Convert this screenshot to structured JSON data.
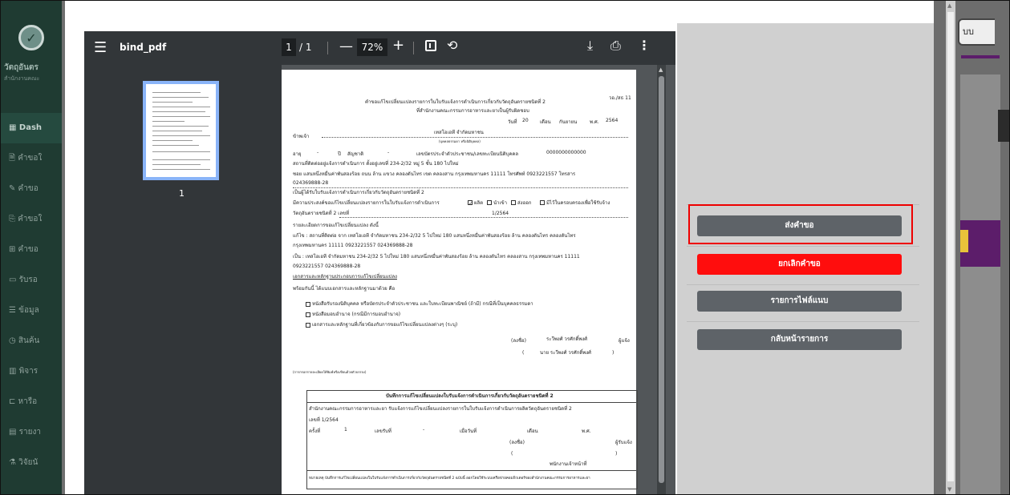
{
  "sidebar": {
    "brand": "วัตถุอันตร",
    "brand_sub": "สำนักงานคณะ",
    "items": [
      {
        "label": "▦ Dash",
        "active": true
      },
      {
        "label": "🗎 คำขอใ"
      },
      {
        "label": "✎ คำขอ"
      },
      {
        "label": "⎘ คำขอใ"
      },
      {
        "label": "⊞ คำขอ"
      },
      {
        "label": "▭ รับรอ"
      },
      {
        "label": "☰ ข้อมูล"
      },
      {
        "label": "◷ สินค้น"
      },
      {
        "label": "▥ พิจาร"
      },
      {
        "label": "⊏ หารือ"
      },
      {
        "label": "▤ รายงา"
      },
      {
        "label": "⚗ วิจัยนั"
      }
    ]
  },
  "background": {
    "top_button_label": "บบ"
  },
  "pdf": {
    "title": "bind_pdf",
    "current_page": "1",
    "total_pages": "/ 1",
    "zoom": "72%",
    "thumb_page_label": "1",
    "icons": {
      "menu": "menu-icon",
      "fit": "fit-page-icon",
      "rotate": "rotate-icon",
      "download": "download-icon",
      "print": "print-icon",
      "more": "more-vertical-icon"
    }
  },
  "document": {
    "form_code": "วอ./สธ 11",
    "title_1": "คำขอแก้ไขเปลี่ยนแปลงรายการในใบรับแจ้งการดำเนินการเกี่ยวกับวัตถุอันตรายชนิดที่ 2",
    "title_2": "ที่สำนักงานคณะกรรมการอาหารและยาเป็นผู้รับผิดชอบ",
    "date_day_label": "วันที่",
    "date_day": "20",
    "date_month_label": "เดือน",
    "date_month": "กันยายน",
    "date_year_label": "พ.ศ.",
    "date_year": "2564",
    "applicant_label": "ข้าพเจ้า",
    "applicant": "เทสโอเอที จำกัดมหาชน",
    "applicant_hint": "(บุคคลธรรมดา หรือนิติบุคคล)",
    "age_label": "อายุ",
    "age": "-",
    "year_label": "ปี",
    "nationality_label": "สัญชาติ",
    "nationality": "-",
    "id_label": "เลขบัตรประจำตัวประชาชน/เลขทะเบียนนิติบุคคล",
    "id_value": "0000000000000",
    "address_line_1": "สถานที่ติดต่ออยู่แจ้งการดำเนินการ ตั้งอยู่เลขที่ 234-2/32 หมู่ 5 ชั้น 180 ไปใหม่",
    "address_line_2": "ซอย แสนหนึ่งหมื่นค่าพันสองร้อย ถนน ล้าน แขวง คลองตันไทร เขต คลองสาน กรุงเทพมหานคร 11111 โทรศัพท์ 0923221557 โทรสาร",
    "address_line_3": "024369888-28",
    "holder_line": "เป็นผู้ได้รับใบรับแจ้งการดำเนินการเกี่ยวกับวัตถุอันตรายชนิดที่ 2",
    "purpose_line": "มีความประสงค์ขอแก้ไขเปลี่ยนแปลงรายการในใบรับแจ้งการดำเนินการ",
    "opt_produce": "ผลิต",
    "opt_import": "นำเข้า",
    "opt_export": "ส่งออก",
    "opt_possess": "มีไว้ในครอบครองเพื่อใช้รับจ้าง",
    "type_line": "วัตถุอันตรายชนิดที่ 2 เลขที่",
    "type_no": "1/2564",
    "details_label": "รายละเอียดการขอแก้ไขเปลี่ยนแปลง ดังนี้",
    "edit_line_1": "แก้ไข : สถานที่ติดต่อ จาก เทสโอเอที จำกัดมหาชน 234-2/32 5 ไปใหม่ 180 แสนหนึ่งหมื่นค่าพันสองร้อย ล้าน คลองตันไทร คลองตันไทร",
    "edit_line_2": "กรุงเทพมหานคร 11111 0923221557 024369888-28",
    "edit_line_3": "เป็น : เทสโอเอที จำกัดมหาชน 234-2/32 5 ไปใหม่ 180 แสนหนึ่งหมื่นค่าพันสองร้อย ล้าน คลองตันไทร คลองสาน กรุงเทพมหานคร 11111",
    "edit_line_4": "0923221557 024369888-28",
    "evidence_label": "เอกสารและหลักฐานประกอบการแก้ไขเปลี่ยนแปลง",
    "attached_label": "พร้อมกันนี้ ได้แนบเอกสารและหลักฐานมาด้วย คือ",
    "doc_1": "หนังสือรับรองนิติบุคคล หรือบัตรประจำตัวประชาชน และใบทะเบียนพาณิชย์ (ถ้ามี) กรณีที่เป็นบุคคลธรรมดา",
    "doc_2": "หนังสือมอบอำนาจ (กรณีมีการมอบอำนาจ)",
    "doc_3": "เอกสารและหลักฐานที่เกี่ยวข้องกับการขอแก้ไขเปลี่ยนแปลงต่างๆ  (ระบุ)",
    "sign_label": "(ลงชื่อ)",
    "sign_name": "ระวีพงศ์ วรศักดิ์พงศ์",
    "sign_role": "ผู้แจ้ง",
    "sign_name_paren": "นาย ระวีพงศ์ วรศักดิ์พงศ์",
    "note_small": "(การกรอกรายละเอียดให้พิมพ์หรือเขียนด้วยตัวบรรจง)",
    "record_title": "บันทึกการแก้ไขเปลี่ยนแปลงใบรับแจ้งการดำเนินการเกี่ยวกับวัตถุอันตรายชนิดที่ 2",
    "record_line_1": "สำนักงานคณะกรรมการอาหารและยา รับแจ้งการแก้ไขเปลี่ยนแปลงรายการในใบรับแจ้งการดำเนินการผลิตวัตถุอันตรายชนิดที่ 2",
    "record_no": "เลขที่ 1/2564",
    "record_time_label": "ครั้งที่",
    "record_time": "1",
    "record_no_label": "เลขรับที่",
    "record_no_value": "-",
    "record_date_label": "เมื่อวันที่",
    "record_month_label": "เดือน",
    "record_year_label": "พ.ศ.",
    "record_sign": "(ลงชื่อ)",
    "record_role": "ผู้รับแจ้ง",
    "record_officer": "พนักงานเจ้าหน้าที่",
    "remark": "หมายเหตุ บันทึกการแก้ไขเปลี่ยนแปลงในใบรับแจ้งการดำเนินการเกี่ยวกับวัตถุอันตรายชนิดที่ 2 ฉบับนี้ ออกโดยใช้ระบบเครือข่ายคอมพิวเตอร์ของสำนักงานคณะกรรมการอาหารและยา"
  },
  "actions": {
    "submit": "ส่งคำขอ",
    "cancel": "ยกเลิกคำขอ",
    "attachments": "รายการไฟล์แนบ",
    "back": "กลับหน้ารายการ"
  },
  "colors": {
    "highlight": "#e00000",
    "danger": "#ff0d0d",
    "gray_button": "#5e6368",
    "sidebar": "#1f3b32"
  }
}
